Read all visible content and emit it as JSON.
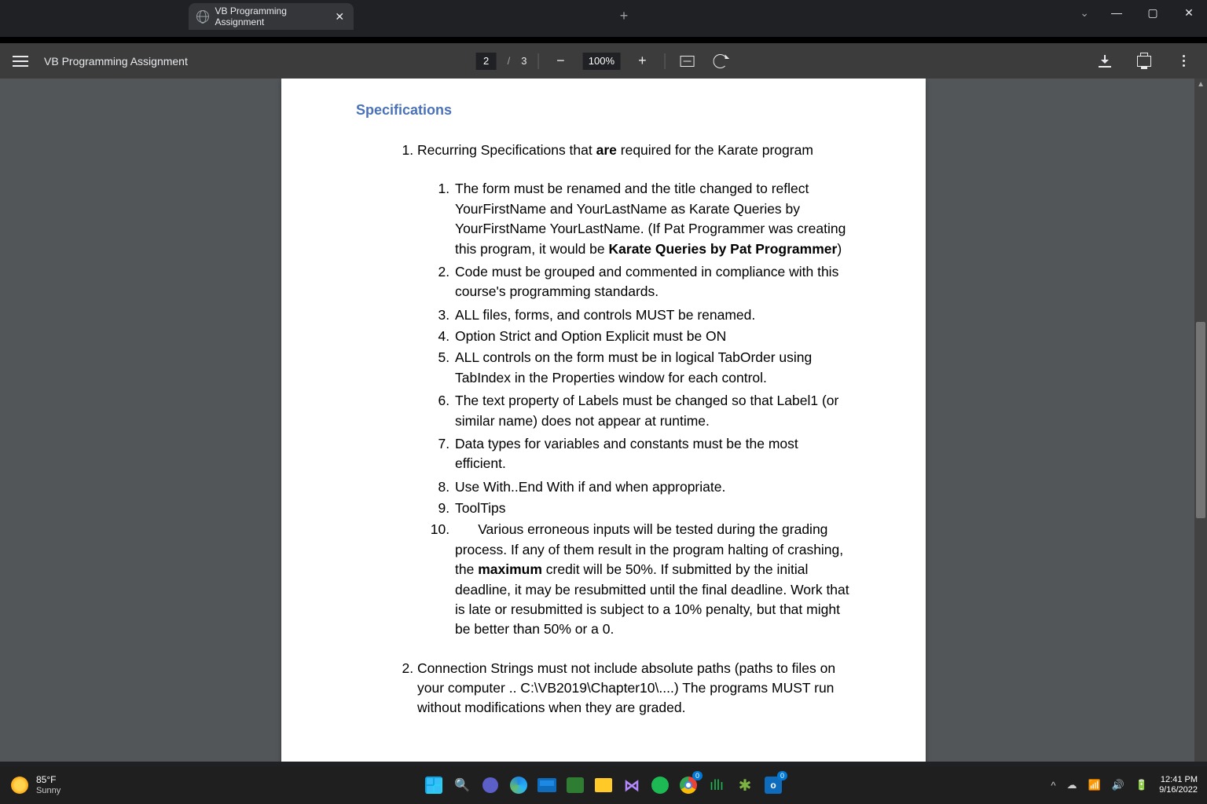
{
  "browser": {
    "tab_title": "VB Programming Assignment"
  },
  "pdf_toolbar": {
    "title": "VB Programming Assignment",
    "page_current": "2",
    "page_sep": "/",
    "page_total": "3",
    "zoom": "100%"
  },
  "document": {
    "heading": "Specifications",
    "item1_pre": "Recurring Specifications that ",
    "item1_bold": "are",
    "item1_post": " required for the Karate program",
    "sub1_pre": "The form must be renamed and the title changed to reflect YourFirstName and YourLastName as Karate Queries by YourFirstName YourLastName. (If Pat Programmer was creating this program, it would be ",
    "sub1_bold": "Karate Queries by Pat Programmer",
    "sub1_post": ")",
    "sub2": "Code must be grouped and commented in compliance with this course's programming standards.",
    "sub3": "ALL files, forms, and controls MUST be renamed.",
    "sub4": "Option Strict and Option Explicit must be ON",
    "sub5": "ALL controls on the form must be in logical TabOrder using TabIndex in the Properties window for each control.",
    "sub6": "The text property of Labels must be changed so that Label1 (or similar name) does not appear at runtime.",
    "sub7": "Data types for variables and constants must be the most efficient.",
    "sub8": "Use With..End With if and when appropriate.",
    "sub9": "ToolTips",
    "sub10_pre": "Various erroneous inputs will be tested during the grading process. If any of them result in the program halting of crashing, the ",
    "sub10_bold": "maximum",
    "sub10_post": " credit will be 50%. If submitted by the initial deadline, it may be resubmitted until the final deadline. Work that is late or resubmitted is subject to a 10% penalty, but that might be better than 50% or a 0.",
    "item2": "Connection Strings must not include absolute paths (paths to files on your computer .. C:\\VB2019\\Chapter10\\....) The programs MUST run without modifications when they are graded."
  },
  "taskbar": {
    "temp": "85°F",
    "condition": "Sunny",
    "time": "12:41 PM",
    "date": "9/16/2022",
    "chrome_badge": "0",
    "outlook_badge": "0"
  }
}
